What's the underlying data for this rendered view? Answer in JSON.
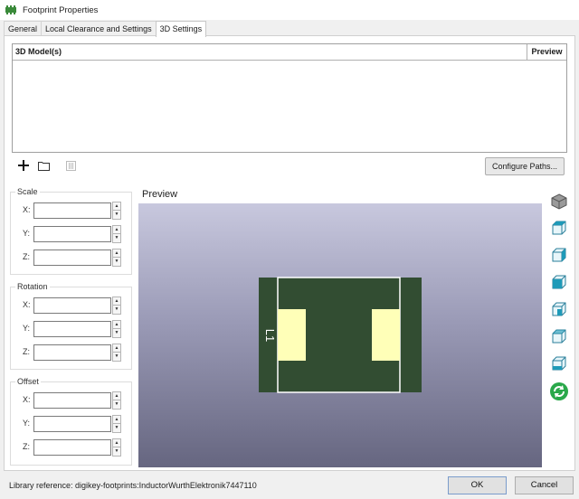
{
  "window": {
    "title": "Footprint Properties",
    "icon": "footprint-icon"
  },
  "tabs": [
    {
      "label": "General",
      "active": false
    },
    {
      "label": "Local Clearance and Settings",
      "active": false
    },
    {
      "label": "3D Settings",
      "active": true
    }
  ],
  "models_table": {
    "columns": [
      "3D Model(s)",
      "Preview"
    ],
    "rows": []
  },
  "toolbar": {
    "add_icon": "plus-icon",
    "browse_icon": "folder-icon",
    "delete_icon": "trash-icon",
    "configure_label": "Configure Paths..."
  },
  "scale": {
    "title": "Scale",
    "x_label": "X:",
    "y_label": "Y:",
    "z_label": "Z:",
    "x": "",
    "y": "",
    "z": ""
  },
  "rotation": {
    "title": "Rotation",
    "x_label": "X:",
    "y_label": "Y:",
    "z_label": "Z:",
    "x": "",
    "y": "",
    "z": ""
  },
  "offset": {
    "title": "Offset",
    "x_label": "X:",
    "y_label": "Y:",
    "z_label": "Z:",
    "x": "",
    "y": "",
    "z": ""
  },
  "preview": {
    "label": "Preview",
    "reference_designator": "L1",
    "colors": {
      "board": "#324d32",
      "pad": "#ffffb8",
      "outline": "#ffffff",
      "bg_top": "#c8c8de",
      "bg_bottom": "#666680"
    }
  },
  "view_buttons": [
    "view-3d-iso-icon",
    "view-top-icon",
    "view-bottom-icon",
    "view-right-icon",
    "view-left-icon",
    "view-front-icon",
    "view-back-icon",
    "reload-icon"
  ],
  "status": {
    "library_reference": "Library reference: digikey-footprints:InductorWurthElektronik7447110"
  },
  "dialog_buttons": {
    "ok": "OK",
    "cancel": "Cancel"
  }
}
